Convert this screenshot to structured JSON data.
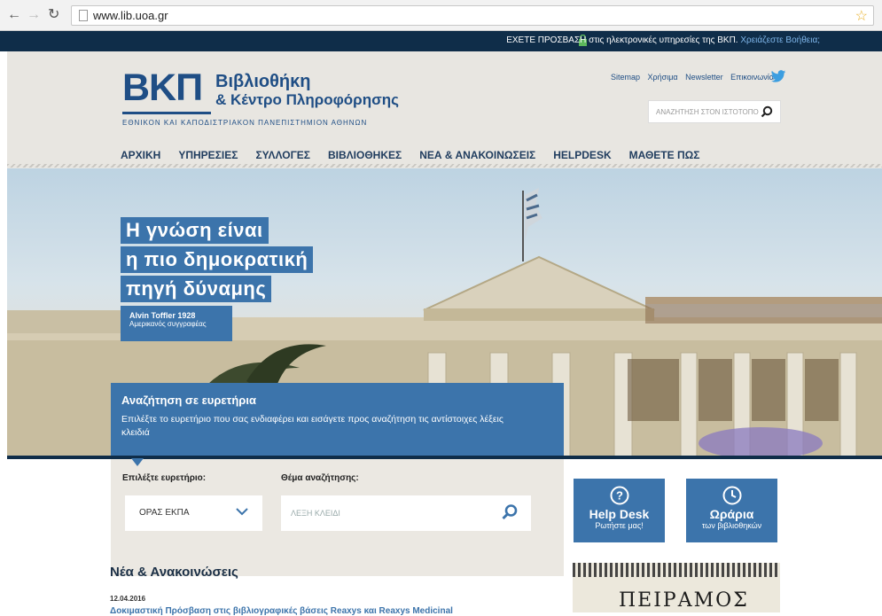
{
  "browser": {
    "url": "www.lib.uoa.gr"
  },
  "topbar": {
    "access_text": "ΕΧΕΤΕ ΠΡΟΣΒΑΣΗ στις ηλεκτρονικές υπηρεσίες της ΒΚΠ.",
    "help_link": "Χρειάζεστε Βοήθεια;"
  },
  "logo": {
    "abbrev": "ΒΚΠ",
    "line1": "Βιβλιοθήκη",
    "line2": "& Κέντρο Πληροφόρησης",
    "subtitle": "ΕΘΝΙΚΟΝ ΚΑΙ ΚΑΠΟΔΙΣΤΡΙΑΚΟΝ ΠΑΝΕΠΙΣΤΗΜΙΟΝ ΑΘΗΝΩΝ"
  },
  "util_links": [
    "Sitemap",
    "Χρήσιμα",
    "Newsletter",
    "Επικοινωνία"
  ],
  "site_search": {
    "placeholder": "ΑΝΑΖΗΤΗΣΗ ΣΤΟΝ ΙΣΤΟΤΟΠΟ"
  },
  "nav": [
    "ΑΡΧΙΚΗ",
    "ΥΠΗΡΕΣΙΕΣ",
    "ΣΥΛΛΟΓΕΣ",
    "ΒΙΒΛΙΟΘΗΚΕΣ",
    "ΝΕΑ & ΑΝΑΚΟΙΝΩΣΕΙΣ",
    "HELPDESK",
    "ΜΑΘΕΤΕ ΠΩΣ"
  ],
  "hero": {
    "quote_lines": [
      "Η γνώση είναι",
      "η πιο δημοκρατική",
      "πηγή δύναμης"
    ],
    "author": "Alvin Toffler 1928",
    "author_desc": "Αμερικανός συγγραφέας"
  },
  "index_search": {
    "title": "Αναζήτηση σε ευρετήρια",
    "description": "Επιλέξτε το ευρετήριο που σας ενδιαφέρει και εισάγετε προς αναζήτηση τις αντίστοιχες λέξεις κλειδιά",
    "select_label": "Επιλέξτε ευρετήριο:",
    "select_value": "ΟΡΑΣ ΕΚΠΑ",
    "keyword_label": "Θέμα αναζήτησης:",
    "keyword_placeholder": "ΛΕΞΗ ΚΛΕΙΔΙ"
  },
  "tiles": [
    {
      "title": "Help Desk",
      "sub": "Ρωτήστε μας!",
      "icon": "question-icon"
    },
    {
      "title": "Ωράρια",
      "sub": "των βιβλιοθηκών",
      "icon": "clock-icon"
    }
  ],
  "news": {
    "title": "Νέα & Ανακοινώσεις",
    "date": "12.04.2016",
    "headline": "Δοκιμαστική Πρόσβαση στις βιβλιογραφικές βάσεις Reaxys και Reaxys Medicinal"
  },
  "banner": {
    "text": "ΠΕΙΡΑΜΟΣ"
  },
  "colors": {
    "brand_blue": "#3c74ab",
    "dark_navy": "#0f2d49",
    "header_bg": "#e8e6e1"
  }
}
